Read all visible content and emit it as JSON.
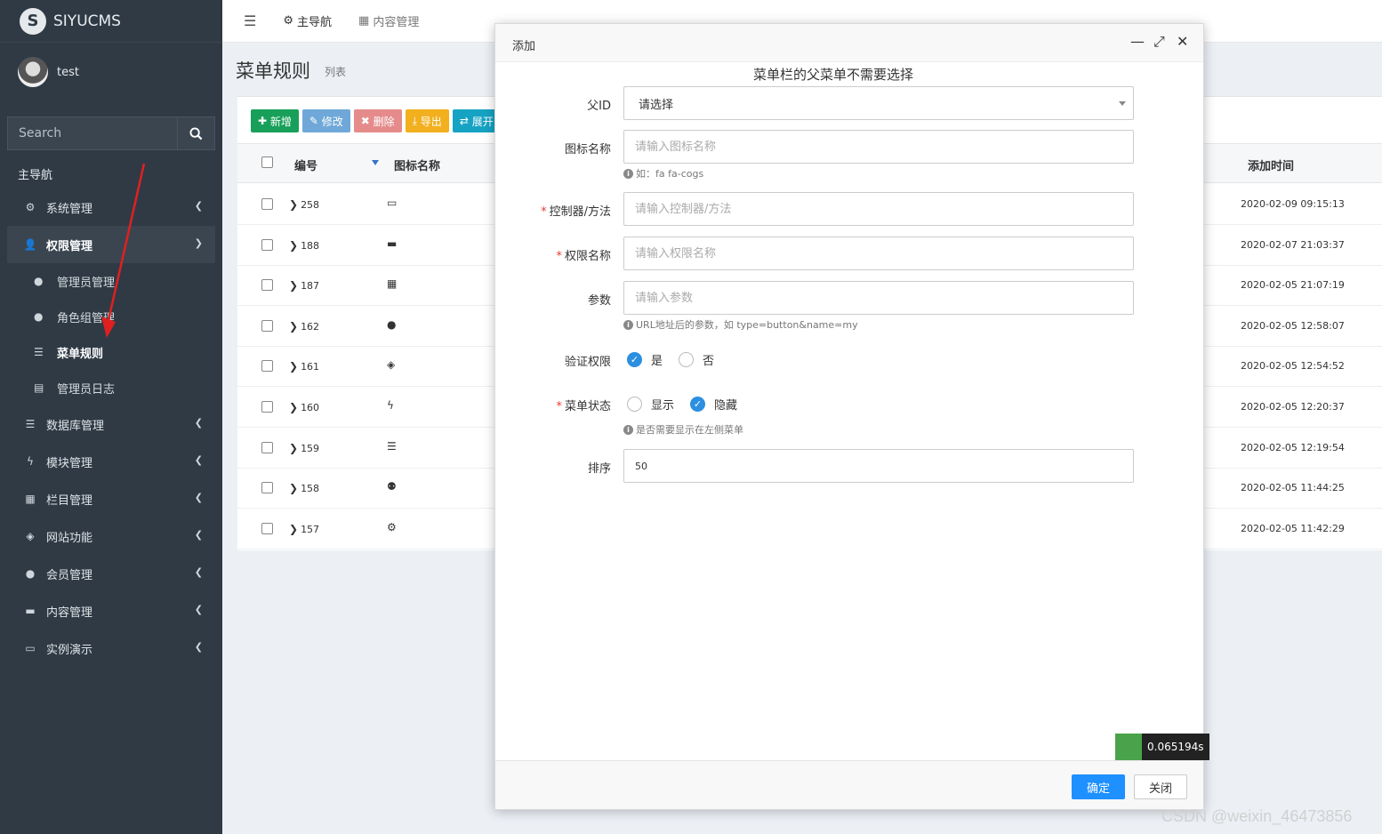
{
  "app": {
    "logo_letter": "S",
    "name": "SIYUCMS"
  },
  "user": {
    "name": "test"
  },
  "search": {
    "placeholder": "Search"
  },
  "nav_header": "主导航",
  "nav": {
    "system": "系统管理",
    "auth": "权限管理",
    "auth_children": [
      "管理员管理",
      "角色组管理",
      "菜单规则",
      "管理员日志"
    ],
    "database": "数据库管理",
    "module": "模块管理",
    "column": "栏目管理",
    "site": "网站功能",
    "member": "会员管理",
    "content": "内容管理",
    "demo": "实例演示"
  },
  "topbar": {
    "tab_main": "主导航",
    "tab_content": "内容管理"
  },
  "page": {
    "title": "菜单规则",
    "subtitle": "列表"
  },
  "toolbar": {
    "add": "新增",
    "edit": "修改",
    "delete": "删除",
    "export": "导出",
    "expand": "展开"
  },
  "table": {
    "headers": {
      "id": "编号",
      "icon": "图标名称",
      "time": "添加时间"
    },
    "rows": [
      {
        "id": "258",
        "icon": "desktop-icon",
        "time": "2020-02-09 09:15:13"
      },
      {
        "id": "188",
        "icon": "briefcase-icon",
        "time": "2020-02-07 21:03:37"
      },
      {
        "id": "187",
        "icon": "grid-icon",
        "time": "2020-02-05 21:07:19"
      },
      {
        "id": "162",
        "icon": "user-icon",
        "time": "2020-02-05 12:58:07"
      },
      {
        "id": "161",
        "icon": "layers-icon",
        "time": "2020-02-05 12:54:52"
      },
      {
        "id": "160",
        "icon": "bolt-icon",
        "time": "2020-02-05 12:20:37"
      },
      {
        "id": "159",
        "icon": "database-icon",
        "time": "2020-02-05 12:19:54"
      },
      {
        "id": "158",
        "icon": "user-gear-icon",
        "time": "2020-02-05 11:44:25"
      },
      {
        "id": "157",
        "icon": "cogs-icon",
        "time": "2020-02-05 11:42:29"
      }
    ]
  },
  "modal": {
    "title": "添加",
    "note": "菜单栏的父菜单不需要选择",
    "parent_label": "父ID",
    "parent_value": "请选择",
    "icon_label": "图标名称",
    "icon_placeholder": "请输入图标名称",
    "icon_hint": "如：fa fa-cogs",
    "controller_label": "控制器/方法",
    "controller_placeholder": "请输入控制器/方法",
    "perm_label": "权限名称",
    "perm_placeholder": "请输入权限名称",
    "param_label": "参数",
    "param_placeholder": "请输入参数",
    "param_hint": "URL地址后的参数，如 type=button&name=my",
    "auth_label": "验证权限",
    "auth_yes": "是",
    "auth_no": "否",
    "status_label": "菜单状态",
    "status_show": "显示",
    "status_hide": "隐藏",
    "status_hint": "是否需要显示在左侧菜单",
    "sort_label": "排序",
    "sort_value": "50",
    "ok": "确定",
    "close": "关闭"
  },
  "trace": "0.065194s",
  "watermark": "CSDN @weixin_46473856",
  "colors": {
    "sidebar": "#2f3a45",
    "primary": "#1e90ff",
    "annotation_arrow": "#e02020"
  }
}
